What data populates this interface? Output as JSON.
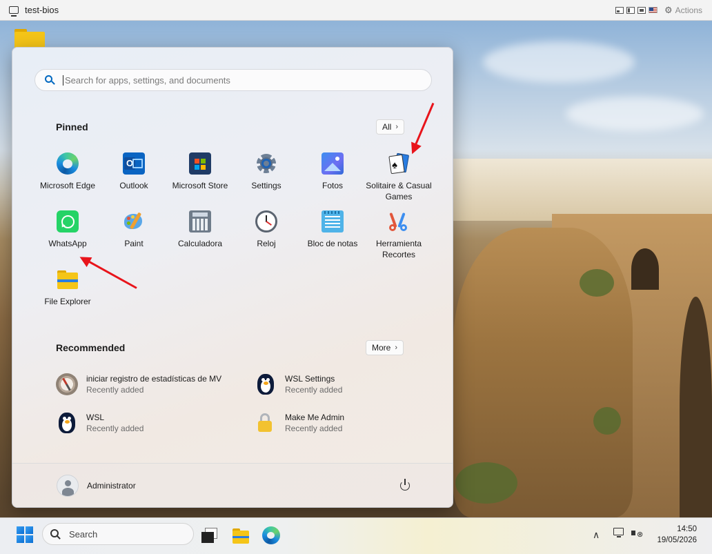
{
  "window": {
    "title": "test-bios",
    "actions_label": "Actions"
  },
  "start_menu": {
    "search_placeholder": "Search for apps, settings, and documents",
    "pinned_title": "Pinned",
    "all_button": "All",
    "pinned_apps": [
      {
        "label": "Microsoft Edge",
        "icon": "edge-icon"
      },
      {
        "label": "Outlook",
        "icon": "outlook-icon"
      },
      {
        "label": "Microsoft Store",
        "icon": "store-icon"
      },
      {
        "label": "Settings",
        "icon": "gear-icon"
      },
      {
        "label": "Fotos",
        "icon": "photos-icon"
      },
      {
        "label": "Solitaire & Casual Games",
        "icon": "solitaire-icon"
      },
      {
        "label": "WhatsApp",
        "icon": "whatsapp-icon"
      },
      {
        "label": "Paint",
        "icon": "paint-palette-icon"
      },
      {
        "label": "Calculadora",
        "icon": "calculator-icon"
      },
      {
        "label": "Reloj",
        "icon": "clock-icon"
      },
      {
        "label": "Bloc de notas",
        "icon": "notepad-icon"
      },
      {
        "label": "Herramienta Recortes",
        "icon": "snipping-tool-icon"
      },
      {
        "label": "File Explorer",
        "icon": "folder-icon"
      }
    ],
    "recommended_title": "Recommended",
    "more_button": "More",
    "recommended": [
      {
        "name": "iniciar registro de estadísticas de MV",
        "sub": "Recently added",
        "icon": "compass-icon"
      },
      {
        "name": "WSL Settings",
        "sub": "Recently added",
        "icon": "penguin-icon"
      },
      {
        "name": "WSL",
        "sub": "Recently added",
        "icon": "penguin-icon"
      },
      {
        "name": "Make Me Admin",
        "sub": "Recently added",
        "icon": "lock-icon"
      }
    ],
    "user_name": "Administrator"
  },
  "taskbar": {
    "search_label": "Search",
    "time": "14:50",
    "date": "19/05/2026"
  },
  "colors": {
    "accent": "#0067c0",
    "annotation_arrow": "#e8141b",
    "whatsapp": "#25d366"
  }
}
